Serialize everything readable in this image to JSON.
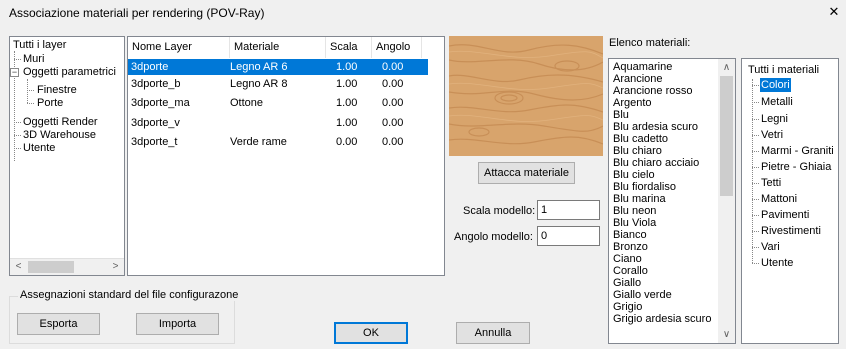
{
  "window": {
    "title": "Associazione materiali per rendering (POV-Ray)",
    "close_glyph": "✕"
  },
  "layer_tree": {
    "items": [
      {
        "label": "Tutti i layer",
        "level": 0
      },
      {
        "label": "Muri",
        "level": 1
      },
      {
        "label": "Oggetti parametrici",
        "level": 1,
        "expander": "−"
      },
      {
        "label": "Finestre",
        "level": 2
      },
      {
        "label": "Porte",
        "level": 2
      },
      {
        "label": "Oggetti Render",
        "level": 1
      },
      {
        "label": "3D Warehouse",
        "level": 1
      },
      {
        "label": "Utente",
        "level": 1
      }
    ],
    "scroll_left": "<",
    "scroll_right": ">"
  },
  "layer_table": {
    "columns": [
      "Nome Layer",
      "Materiale",
      "Scala",
      "Angolo"
    ],
    "rows": [
      {
        "name": "3dporte",
        "material": "Legno AR 6",
        "scale": "1.00",
        "angle": "0.00",
        "selected": true
      },
      {
        "name": "3dporte_b",
        "material": "Legno AR 8",
        "scale": "1.00",
        "angle": "0.00"
      },
      {
        "name": "3dporte_ma",
        "material": "Ottone",
        "scale": "1.00",
        "angle": "0.00"
      },
      {
        "name": "3dporte_v",
        "material": "",
        "scale": "1.00",
        "angle": "0.00"
      },
      {
        "name": "3dporte_t",
        "material": "Verde rame",
        "scale": "0.00",
        "angle": "0.00"
      }
    ]
  },
  "preview": {
    "attach_label": "Attacca materiale"
  },
  "model": {
    "scale_label": "Scala modello:",
    "scale_value": "1",
    "angle_label": "Angolo modello:",
    "angle_value": "0"
  },
  "materials": {
    "title": "Elenco materiali:",
    "items": [
      "Aquamarine",
      "Arancione",
      "Arancione rosso",
      "Argento",
      "Blu",
      "Blu ardesia scuro",
      "Blu cadetto",
      "Blu chiaro",
      "Blu chiaro acciaio",
      "Blu cielo",
      "Blu fiordaliso",
      "Blu marina",
      "Blu neon",
      "Blu Viola",
      "Bianco",
      "Bronzo",
      "Ciano",
      "Corallo",
      "Giallo",
      "Giallo verde",
      "Grigio",
      "Grigio ardesia scuro"
    ],
    "scroll_up": "∧",
    "scroll_down": "∨"
  },
  "categories": {
    "items": [
      {
        "label": "Tutti i materiali",
        "level": 0
      },
      {
        "label": "Colori",
        "level": 1,
        "selected": true
      },
      {
        "label": "Metalli",
        "level": 1
      },
      {
        "label": "Legni",
        "level": 1
      },
      {
        "label": "Vetri",
        "level": 1
      },
      {
        "label": "Marmi - Graniti",
        "level": 1
      },
      {
        "label": "Pietre - Ghiaia",
        "level": 1
      },
      {
        "label": "Tetti",
        "level": 1
      },
      {
        "label": "Mattoni",
        "level": 1
      },
      {
        "label": "Pavimenti",
        "level": 1
      },
      {
        "label": "Rivestimenti",
        "level": 1
      },
      {
        "label": "Vari",
        "level": 1
      },
      {
        "label": "Utente",
        "level": 1
      }
    ]
  },
  "standard_group": {
    "title": "Assegnazioni standard del file configurazone",
    "export_label": "Esporta",
    "import_label": "Importa"
  },
  "dialog_buttons": {
    "ok_label": "OK",
    "cancel_label": "Annulla"
  },
  "colors": {
    "selection": "#0078d7",
    "window_bg": "#f0f0f0",
    "wood_base": "#d8a46c",
    "wood_grain": "#c58a52"
  }
}
